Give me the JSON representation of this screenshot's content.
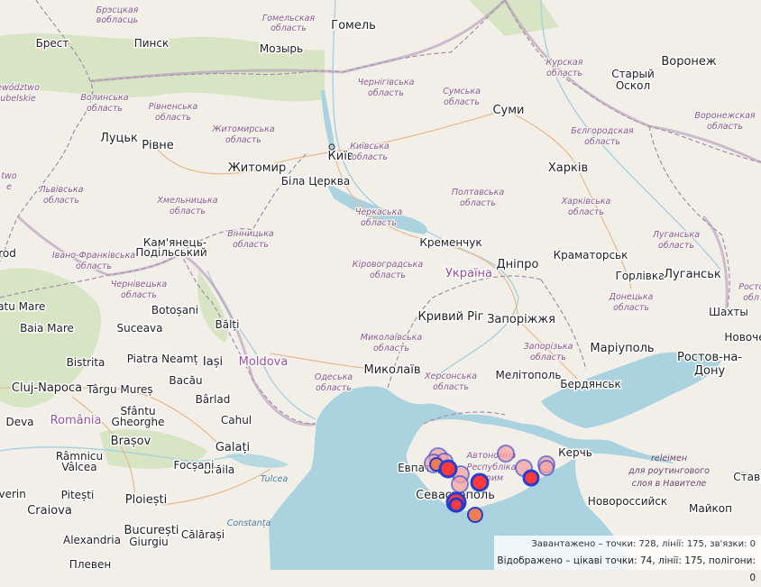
{
  "map": {
    "cities": [
      {
        "id": "gomel",
        "label": "Гомель",
        "big": true
      },
      {
        "id": "brest",
        "label": "Брест"
      },
      {
        "id": "pinsk",
        "label": "Пинск"
      },
      {
        "id": "mozyr",
        "label": "Мозырь"
      },
      {
        "id": "lutsk",
        "label": "Луцьк",
        "big": true
      },
      {
        "id": "rivne",
        "label": "Рівне",
        "big": true
      },
      {
        "id": "zhytomyr",
        "label": "Житомир",
        "big": true
      },
      {
        "id": "kyiv",
        "label": "Київ",
        "big": true
      },
      {
        "id": "bila",
        "label": "Біла Церква"
      },
      {
        "id": "sumy",
        "label": "Суми",
        "big": true
      },
      {
        "id": "kharkiv",
        "label": "Харків",
        "big": true
      },
      {
        "id": "voronezh",
        "label": "Воронеж",
        "big": true
      },
      {
        "id": "staryi",
        "label": "Старый"
      },
      {
        "id": "oskol",
        "label": "Оскол"
      },
      {
        "id": "kremenchuk",
        "label": "Кременчук"
      },
      {
        "id": "dnipro",
        "label": "Дніпро",
        "big": true
      },
      {
        "id": "kramatorsk",
        "label": "Краматорськ"
      },
      {
        "id": "horlivka",
        "label": "Горлівка"
      },
      {
        "id": "luhansk",
        "label": "Луганськ",
        "big": true
      },
      {
        "id": "kamianets1",
        "label": "Кам'янець-"
      },
      {
        "id": "kamianets2",
        "label": "Подільський"
      },
      {
        "id": "kryvyi",
        "label": "Кривий Ріг",
        "big": true
      },
      {
        "id": "zaporizhzhia",
        "label": "Запоріжжя",
        "big": true
      },
      {
        "id": "shakhty",
        "label": "Шахты"
      },
      {
        "id": "novocherkassk",
        "label": "Новоче"
      },
      {
        "id": "botosani",
        "label": "Botoșani"
      },
      {
        "id": "balti",
        "label": "Bălți"
      },
      {
        "id": "satu",
        "label": "Satu Mare"
      },
      {
        "id": "baia",
        "label": "Baia Mare"
      },
      {
        "id": "suceava",
        "label": "Suceava"
      },
      {
        "id": "mariupol",
        "label": "Маріуполь",
        "big": true
      },
      {
        "id": "rostov1",
        "label": "Ростов-на-",
        "big": true
      },
      {
        "id": "rostov2",
        "label": "Дону",
        "big": true
      },
      {
        "id": "bistrita",
        "label": "Bistrita"
      },
      {
        "id": "piatra",
        "label": "Piatra Neamț"
      },
      {
        "id": "iasi",
        "label": "Iași",
        "big": true
      },
      {
        "id": "mykolaiv",
        "label": "Миколаїв",
        "big": true
      },
      {
        "id": "melitopol",
        "label": "Мелітополь"
      },
      {
        "id": "berdiansk",
        "label": "Бердянськ"
      },
      {
        "id": "cluj",
        "label": "Cluj-Napoca",
        "big": true
      },
      {
        "id": "targu",
        "label": "Târgu Mureș"
      },
      {
        "id": "bacau",
        "label": "Bacău"
      },
      {
        "id": "barlad",
        "label": "Bârlad"
      },
      {
        "id": "sfantu1",
        "label": "Sfântu"
      },
      {
        "id": "sfantu2",
        "label": "Gheorghe"
      },
      {
        "id": "cahul",
        "label": "Cahul"
      },
      {
        "id": "deva",
        "label": "Deva"
      },
      {
        "id": "galati",
        "label": "Galați",
        "big": true
      },
      {
        "id": "brasov",
        "label": "Brașov",
        "big": true
      },
      {
        "id": "ramnicu1",
        "label": "Râmnicu"
      },
      {
        "id": "ramnicu2",
        "label": "Vâlcea"
      },
      {
        "id": "braila",
        "label": "Brăila"
      },
      {
        "id": "evpatoria",
        "label": "Евпатор"
      },
      {
        "id": "kerch",
        "label": "Керчь"
      },
      {
        "id": "sevastopol",
        "label": "Севастополь",
        "big": true
      },
      {
        "id": "pitesti",
        "label": "Pitești"
      },
      {
        "id": "ploiesti",
        "label": "Ploiești",
        "big": true
      },
      {
        "id": "focsani",
        "label": "Focșani"
      },
      {
        "id": "novorossiysk",
        "label": "Новороссийск"
      },
      {
        "id": "maykop",
        "label": "Майкоп"
      },
      {
        "id": "stavr",
        "label": "Ставр"
      },
      {
        "id": "severin",
        "label": "everin"
      },
      {
        "id": "craiova",
        "label": "Craiova",
        "big": true
      },
      {
        "id": "bucuresti",
        "label": "București",
        "big": true
      },
      {
        "id": "alexandria",
        "label": "Alexandria"
      },
      {
        "id": "giurgiu",
        "label": "Giurgiu"
      },
      {
        "id": "calarasi",
        "label": "Călărași"
      },
      {
        "id": "pleven",
        "label": "Плевен"
      }
    ],
    "regions": [
      {
        "id": "r1a",
        "label": "Брэсцкая"
      },
      {
        "id": "r1b",
        "label": "вобласць"
      },
      {
        "id": "r2a",
        "label": "Гомельская"
      },
      {
        "id": "r2b",
        "label": "область"
      },
      {
        "id": "r3a",
        "label": "Чернігівська"
      },
      {
        "id": "r3b",
        "label": "область"
      },
      {
        "id": "r4a",
        "label": "Сумська"
      },
      {
        "id": "r4b",
        "label": "область"
      },
      {
        "id": "r5a",
        "label": "Курская"
      },
      {
        "id": "r5b",
        "label": "область"
      },
      {
        "id": "r6a",
        "label": "Волинська"
      },
      {
        "id": "r6b",
        "label": "область"
      },
      {
        "id": "r7a",
        "label": "Рівненська"
      },
      {
        "id": "r7b",
        "label": "область"
      },
      {
        "id": "r8a",
        "label": "Житомирська"
      },
      {
        "id": "r8b",
        "label": "область"
      },
      {
        "id": "r9a",
        "label": "Київська"
      },
      {
        "id": "r9b",
        "label": "область"
      },
      {
        "id": "r10a",
        "label": "Бєлгородская"
      },
      {
        "id": "r10b",
        "label": "область"
      },
      {
        "id": "r11a",
        "label": "Воронежская"
      },
      {
        "id": "r11b",
        "label": "область"
      },
      {
        "id": "r12a",
        "label": "Львівська"
      },
      {
        "id": "r12b",
        "label": "область"
      },
      {
        "id": "r13a",
        "label": "Хмельницька"
      },
      {
        "id": "r13b",
        "label": "область"
      },
      {
        "id": "r14a",
        "label": "Полтавська"
      },
      {
        "id": "r14b",
        "label": "область"
      },
      {
        "id": "r15a",
        "label": "Харківська"
      },
      {
        "id": "r15b",
        "label": "область"
      },
      {
        "id": "r16a",
        "label": "Черкаська"
      },
      {
        "id": "r16b",
        "label": "область"
      },
      {
        "id": "r17a",
        "label": "Вінницька"
      },
      {
        "id": "r17b",
        "label": "область"
      },
      {
        "id": "r18a",
        "label": "Луганська"
      },
      {
        "id": "r18b",
        "label": "область"
      },
      {
        "id": "r19a",
        "label": "Івано-Франківська"
      },
      {
        "id": "r19b",
        "label": "область"
      },
      {
        "id": "r20a",
        "label": "Кіровоградська"
      },
      {
        "id": "r20b",
        "label": "область"
      },
      {
        "id": "r21a",
        "label": "Чернівецька"
      },
      {
        "id": "r21b",
        "label": "область"
      },
      {
        "id": "r22a",
        "label": "Донецька"
      },
      {
        "id": "r22b",
        "label": "область"
      },
      {
        "id": "r23a",
        "label": "Миколаївська"
      },
      {
        "id": "r23b",
        "label": "область"
      },
      {
        "id": "r24a",
        "label": "Запорізька"
      },
      {
        "id": "r24b",
        "label": "область"
      },
      {
        "id": "r25a",
        "label": "Одеська"
      },
      {
        "id": "r25b",
        "label": "область"
      },
      {
        "id": "r26a",
        "label": "Херсонська"
      },
      {
        "id": "r26b",
        "label": "область"
      },
      {
        "id": "r27a",
        "label": "Автономна"
      },
      {
        "id": "r27b",
        "label": "Республіка"
      },
      {
        "id": "r27c",
        "label": "Крим"
      },
      {
        "id": "r28a",
        "label": "Ростс"
      },
      {
        "id": "r28b",
        "label": "обл"
      },
      {
        "id": "r29a",
        "label": "ewództwo"
      },
      {
        "id": "r29b",
        "label": "ubelskie"
      },
      {
        "id": "r30a",
        "label": "twо"
      },
      {
        "id": "r30b",
        "label": "e"
      }
    ],
    "countries": [
      {
        "id": "ukraine",
        "label": "Україна"
      },
      {
        "id": "moldova",
        "label": "Moldova"
      },
      {
        "id": "romania",
        "label": "România"
      }
    ],
    "sea_labels": [
      {
        "id": "tulcea",
        "label": "Tulcea"
      },
      {
        "id": "constanta",
        "label": "Constanța"
      }
    ],
    "notes": [
      {
        "id": "n1",
        "label": "relеiмен"
      },
      {
        "id": "n2",
        "label": "для роутингового"
      },
      {
        "id": "n3",
        "label": "слоя в Навителе"
      }
    ],
    "partial_labels": [
      {
        "id": "p1",
        "label": "rod"
      }
    ],
    "colors": {
      "land": "#f2efe9",
      "sea": "#aad3df",
      "forest": "#cde2b8",
      "border": "#a58da9",
      "road": "#e9b98b",
      "poi_fill": "#ff3a3a",
      "poi_stroke": "#1a3bd6",
      "poi_soft": "#f4a3a3"
    },
    "markers": [
      {
        "id": "m1",
        "kind": "faded"
      },
      {
        "id": "m2",
        "kind": "faded"
      },
      {
        "id": "m3",
        "kind": "faded"
      },
      {
        "id": "m4",
        "kind": "orange"
      },
      {
        "id": "m5",
        "kind": "faded"
      },
      {
        "id": "m6",
        "kind": "solid"
      },
      {
        "id": "m7",
        "kind": "faded"
      },
      {
        "id": "m8",
        "kind": "solid"
      },
      {
        "id": "m9",
        "kind": "faded"
      },
      {
        "id": "m10",
        "kind": "faded"
      },
      {
        "id": "m11",
        "kind": "faded"
      },
      {
        "id": "m12",
        "kind": "solid"
      },
      {
        "id": "m13",
        "kind": "faded"
      },
      {
        "id": "m14",
        "kind": "solid"
      },
      {
        "id": "m15",
        "kind": "solid"
      },
      {
        "id": "m16",
        "kind": "orange"
      }
    ]
  },
  "status": {
    "loaded": "Завантажено – точки: 728, лінії: 175, зв'язки: 0",
    "shown": "Відображено – цікаві точки: 74, лінії: 175, полігони: 0"
  }
}
